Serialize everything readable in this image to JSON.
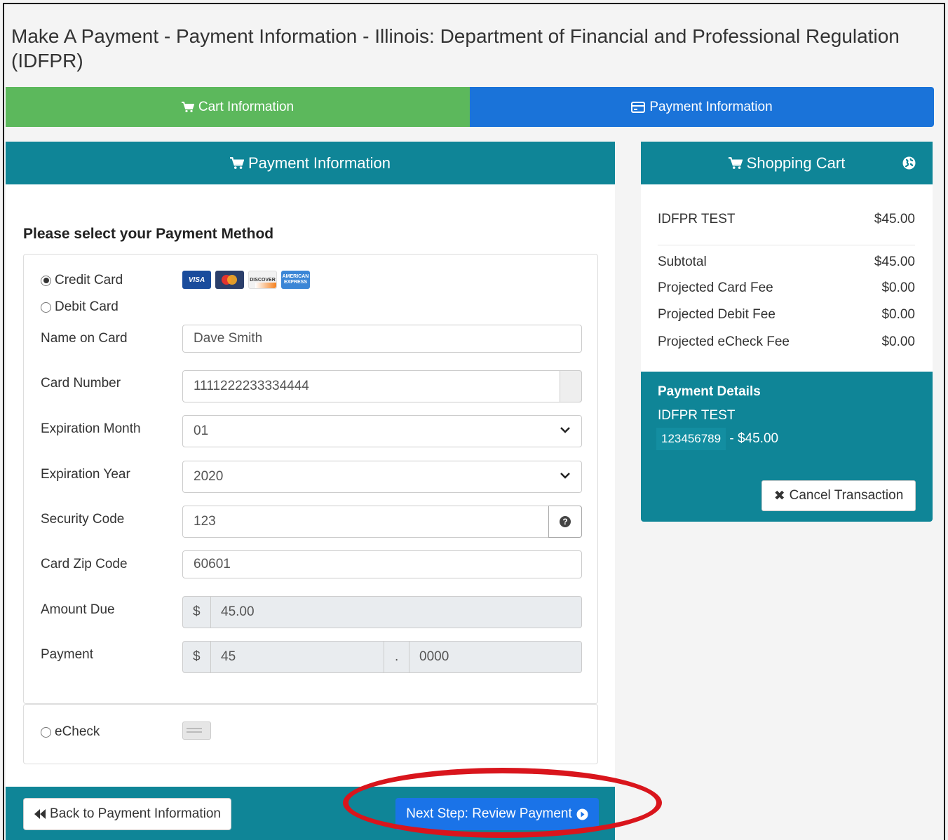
{
  "page": {
    "title": "Make A Payment - Payment Information - Illinois: Department of Financial and Professional Regulation (IDFPR)"
  },
  "steps": [
    {
      "label": "Cart Information",
      "icon": "cart-icon",
      "color": "#5cb85c"
    },
    {
      "label": "Payment Information",
      "icon": "credit-card-icon",
      "color": "#1a73d9"
    }
  ],
  "payment_panel": {
    "header": "Payment Information",
    "section_title": "Please select your Payment Method",
    "methods": {
      "credit_label": "Credit Card",
      "debit_label": "Debit Card",
      "echeck_label": "eCheck",
      "selected": "Credit Card"
    },
    "card_logos": {
      "visa": "VISA",
      "discover": "DISCOVER",
      "amex": "AMERICAN EXPRESS"
    },
    "fields": {
      "name_label": "Name on Card",
      "name_value": "Dave Smith",
      "number_label": "Card Number",
      "number_value": "1111222233334444",
      "month_label": "Expiration Month",
      "month_value": "01",
      "year_label": "Expiration Year",
      "year_value": "2020",
      "security_label": "Security Code",
      "security_value": "123",
      "zip_label": "Card Zip Code",
      "zip_value": "60601",
      "amount_label": "Amount Due",
      "amount_currency": "$",
      "amount_value": "45.00",
      "payment_label": "Payment",
      "payment_currency": "$",
      "payment_dollars": "45",
      "payment_separator": ".",
      "payment_cents": "0000"
    },
    "buttons": {
      "back": "Back to Payment Information",
      "next": "Next Step: Review Payment"
    }
  },
  "cart_panel": {
    "header": "Shopping Cart",
    "item": {
      "name": "IDFPR TEST",
      "amount": "$45.00"
    },
    "rows": [
      {
        "label": "Subtotal",
        "value": "$45.00"
      },
      {
        "label": "Projected Card Fee",
        "value": "$0.00"
      },
      {
        "label": "Projected Debit Fee",
        "value": "$0.00"
      },
      {
        "label": "Projected eCheck Fee",
        "value": "$0.00"
      }
    ],
    "details": {
      "title": "Payment Details",
      "item": "IDFPR TEST",
      "account": "123456789",
      "amount": " - $45.00"
    },
    "cancel_label": "Cancel Transaction"
  },
  "colors": {
    "teal": "#0f8597",
    "green": "#5cb85c",
    "blue": "#1a73d9",
    "highlight": "#d9151c"
  }
}
